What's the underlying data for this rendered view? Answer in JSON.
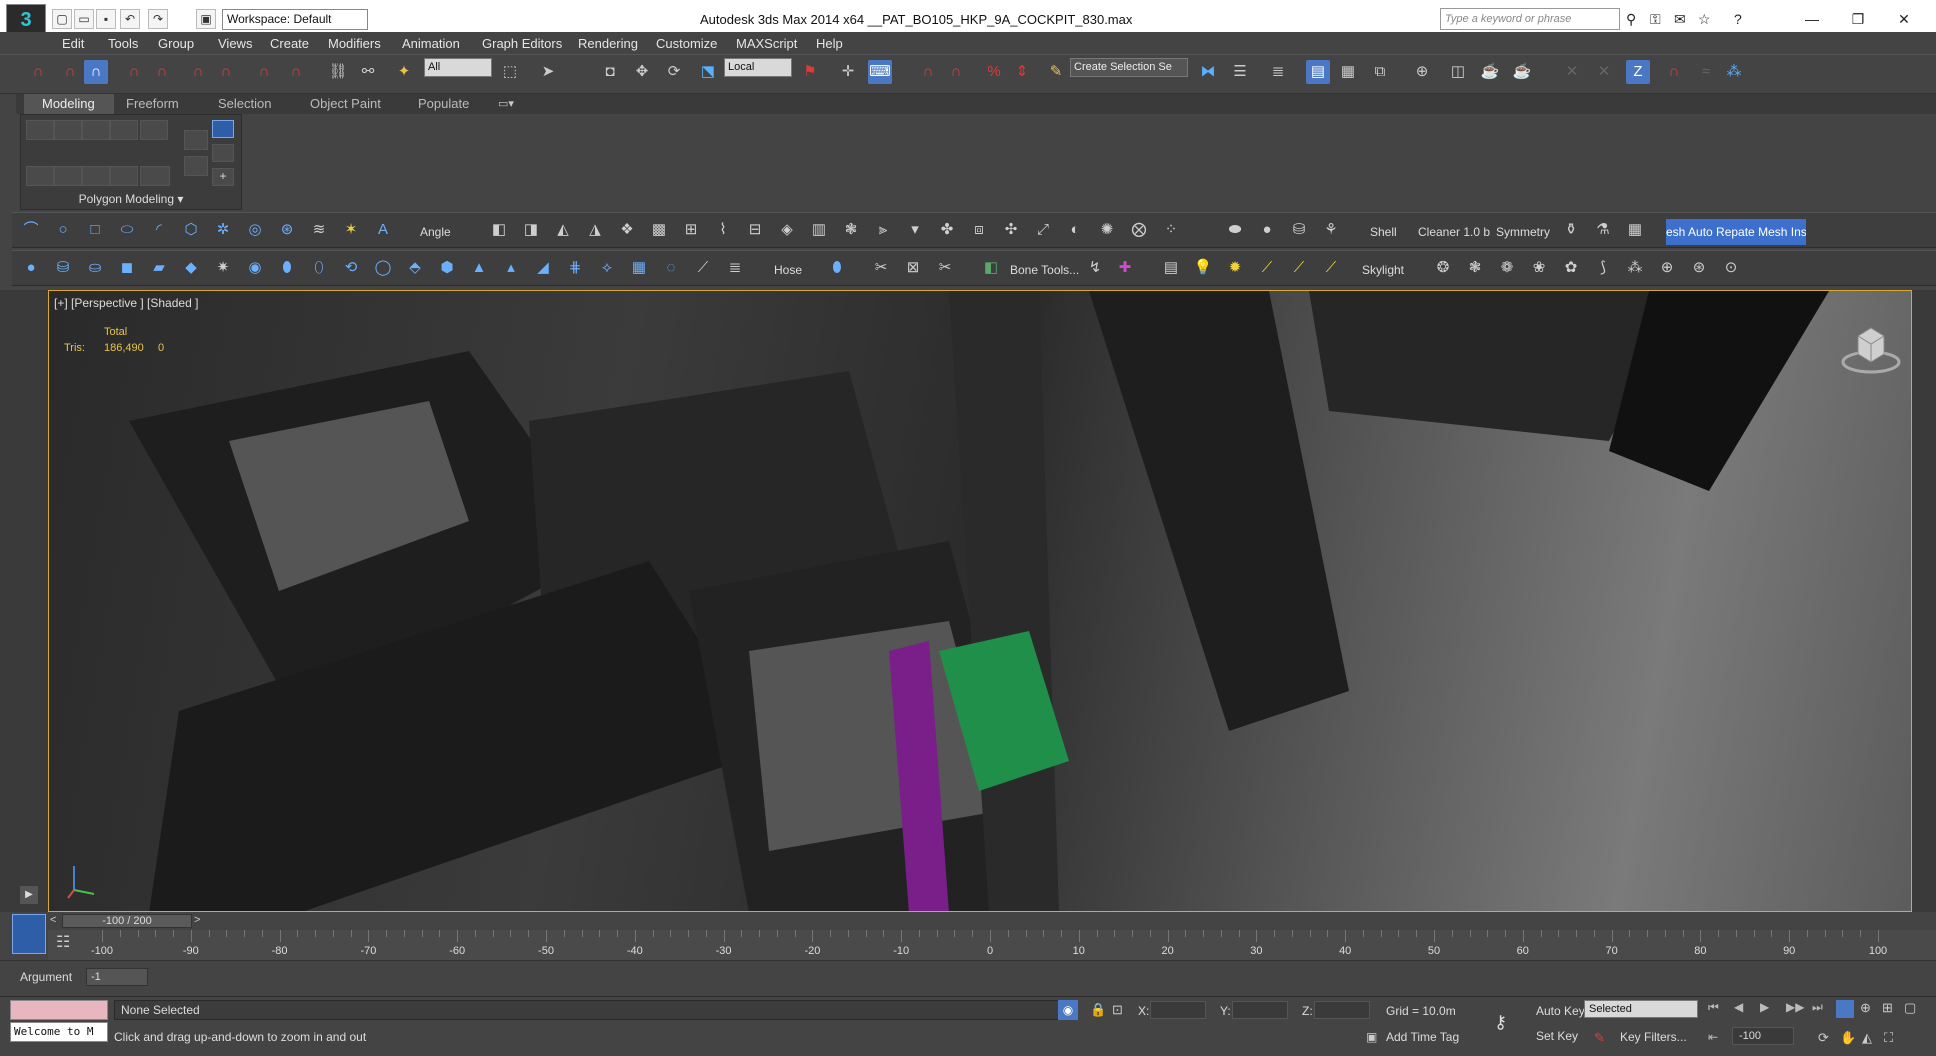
{
  "title_bar": {
    "workspace": "Workspace: Default",
    "app_title": "Autodesk 3ds Max  2014 x64     __PAT_BO105_HKP_9A_COCKPIT_830.max",
    "search_placeholder": "Type a keyword or phrase"
  },
  "menu": [
    "Edit",
    "Tools",
    "Group",
    "Views",
    "Create",
    "Modifiers",
    "Animation",
    "Graph Editors",
    "Rendering",
    "Customize",
    "MAXScript",
    "Help"
  ],
  "main_toolbar": {
    "selection_filter": "All",
    "coord_system": "Local",
    "named_selection": "Create Selection Se"
  },
  "ribbon": {
    "tabs": [
      "Modeling",
      "Freeform",
      "Selection",
      "Object Paint",
      "Populate"
    ],
    "active_tab": "Modeling",
    "panel_label": "Polygon Modeling ▾"
  },
  "command_bar1": {
    "angle_label": "Angle",
    "shell_label": "Shell",
    "cleaner_label": "Cleaner 1.0 b",
    "symmetry_label": "Symmetry",
    "mesh_button": "esh Auto Repate Mesh Insp"
  },
  "command_bar2": {
    "hose_label": "Hose",
    "bone_tools_label": "Bone Tools...",
    "skylight_label": "Skylight"
  },
  "viewport": {
    "label": "[+] [Perspective ] [Shaded ]",
    "stats_total": "Total",
    "stats_tris_label": "Tris:",
    "stats_tris_value": "186,490",
    "stats_zero": "0"
  },
  "timeline": {
    "slider": "-100 / 200",
    "ticks": [
      "-100",
      "-90",
      "-80",
      "-70",
      "-60",
      "-50",
      "-40",
      "-30",
      "-20",
      "-10",
      "0",
      "10",
      "20",
      "30",
      "40",
      "50",
      "60",
      "70",
      "80",
      "90",
      "100"
    ]
  },
  "argument": {
    "label": "Argument",
    "value": "-1"
  },
  "status": {
    "welcome": "Welcome to M",
    "selection": "None Selected",
    "prompt": "Click and drag up-and-down to zoom in and out",
    "x_label": "X:",
    "y_label": "Y:",
    "z_label": "Z:",
    "grid": "Grid = 10.0m",
    "add_time_tag": "Add Time Tag",
    "auto_key": "Auto Key",
    "set_key": "Set Key",
    "key_mode": "Selected",
    "key_filters": "Key Filters...",
    "frame": "-100"
  },
  "colors": {
    "accent": "#4a78c4",
    "viewport_border": "#d8a92b",
    "stats": "#e8c34a"
  }
}
